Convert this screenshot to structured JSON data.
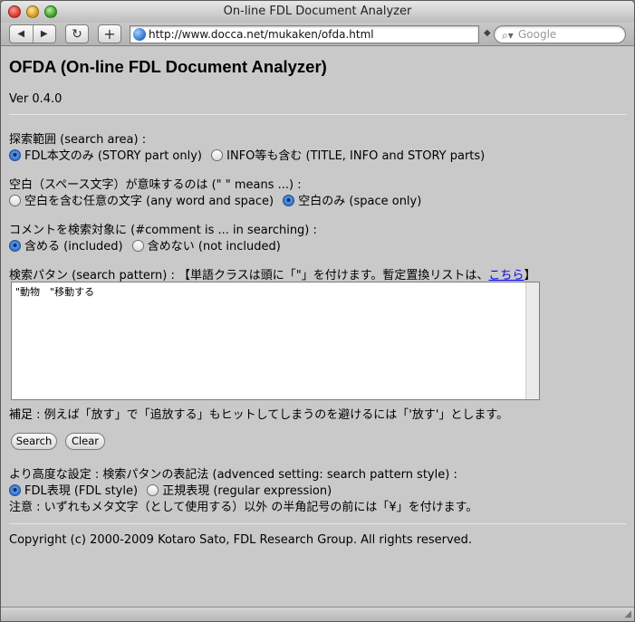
{
  "window": {
    "title": "On-line FDL Document Analyzer"
  },
  "toolbar": {
    "back": "◀",
    "forward": "▶",
    "reload": "↻",
    "add": "+",
    "url": "http://www.docca.net/mukaken/ofda.html",
    "search_placeholder": "Google"
  },
  "page": {
    "title": "OFDA (On-line FDL Document Analyzer)",
    "version": "Ver 0.4.0",
    "search_area": {
      "label": "探索範囲 (search area) :",
      "opt1": "FDL本文のみ (STORY part only)",
      "opt2": "INFO等も含む (TITLE, INFO and STORY parts)"
    },
    "space": {
      "label": "空白（スペース文字）が意味するのは (\" \" means ...) :",
      "opt1": "空白を含む任意の文字 (any word and space)",
      "opt2": "空白のみ (space only)"
    },
    "comment": {
      "label": "コメントを検索対象に (#comment is ... in searching) :",
      "opt1": "含める (included)",
      "opt2": "含めない (not included)"
    },
    "pattern": {
      "label": "検索パタン (search pattern) : 【単語クラスは頭に「\"」を付けます。暫定置換リストは、",
      "link": "こちら",
      "end": "】",
      "value": "\"動物　\"移動する"
    },
    "note1": "補足 : 例えば「放す」で「追放する」もヒットしてしまうのを避けるには「'放す'」とします。",
    "search_button": "Search",
    "clear_button": "Clear",
    "advanced": {
      "label": "より高度な設定 : 検索パタンの表記法 (advenced setting: search pattern style) :",
      "opt1": "FDL表現 (FDL style)",
      "opt2": "正規表現 (regular expression)"
    },
    "note2": "注意 : いずれもメタ文字（として使用する）以外 の半角記号の前には「¥」を付けます。",
    "copyright": "Copyright (c) 2000-2009 Kotaro Sato, FDL Research Group. All rights reserved."
  }
}
